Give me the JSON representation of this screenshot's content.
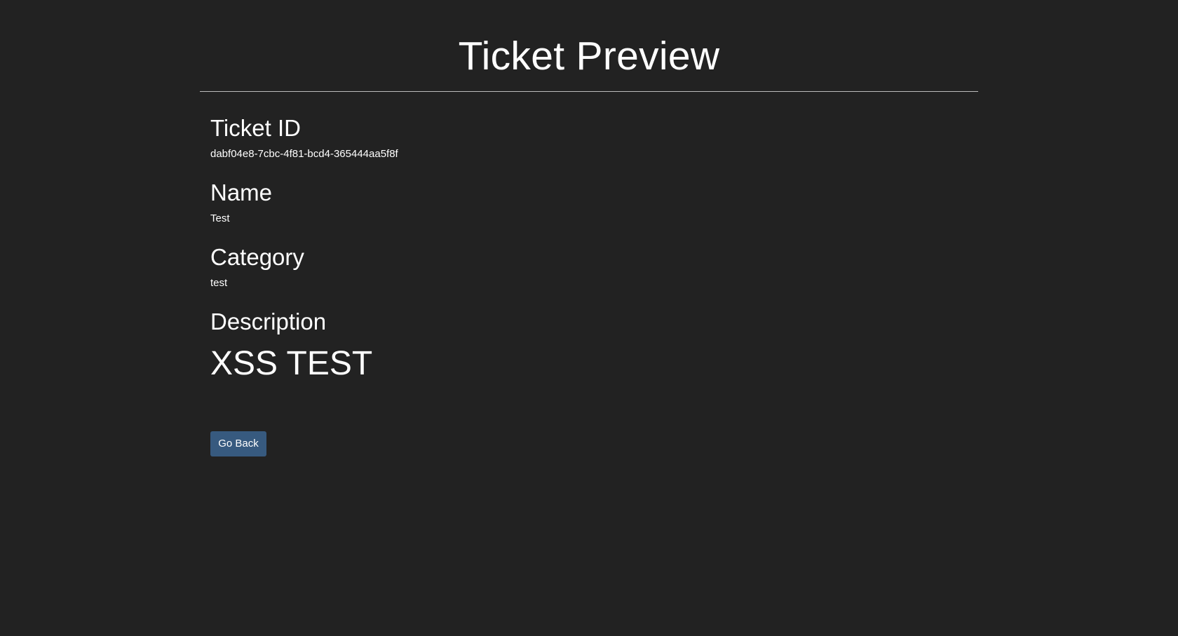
{
  "page": {
    "title": "Ticket Preview"
  },
  "ticket": {
    "id_label": "Ticket ID",
    "id_value": "dabf04e8-7cbc-4f81-bcd4-365444aa5f8f",
    "name_label": "Name",
    "name_value": "Test",
    "category_label": "Category",
    "category_value": "test",
    "description_label": "Description",
    "description_value": "XSS TEST"
  },
  "actions": {
    "go_back_label": "Go Back"
  },
  "colors": {
    "background": "#222222",
    "text": "#ffffff",
    "divider": "#bdbdbd",
    "button": "#375a7f"
  }
}
